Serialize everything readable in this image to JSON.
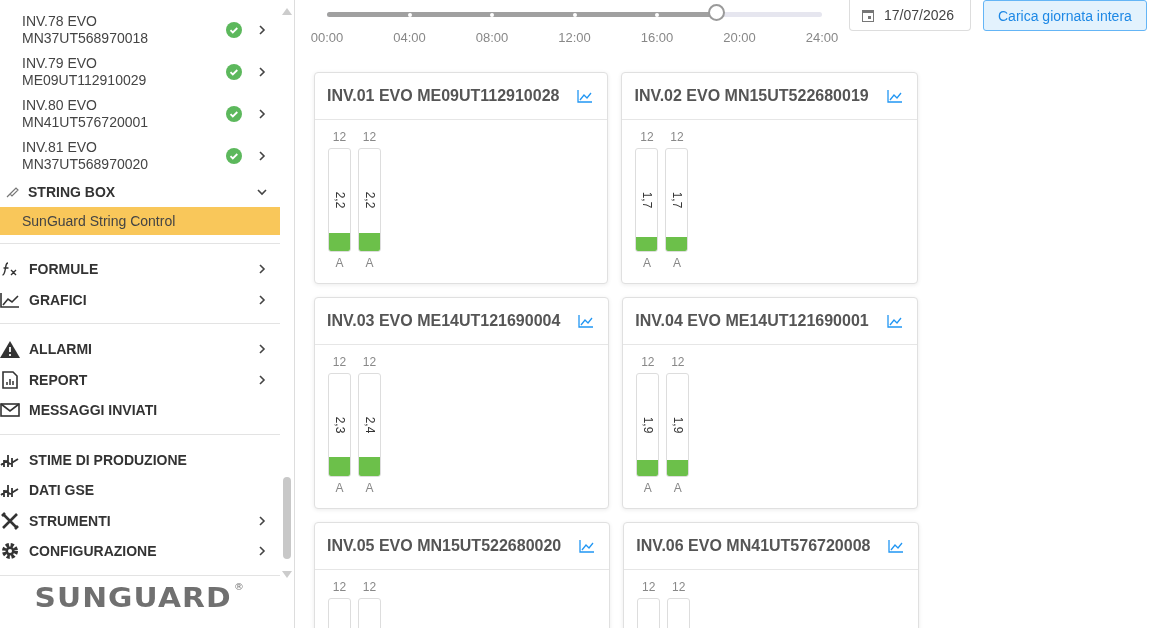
{
  "sidebar": {
    "inverters": [
      {
        "line1": "INV.78 EVO",
        "line2": "MN37UT568970018",
        "ok": true
      },
      {
        "line1": "INV.79 EVO",
        "line2": "ME09UT112910029",
        "ok": true
      },
      {
        "line1": "INV.80 EVO",
        "line2": "MN41UT576720001",
        "ok": true
      },
      {
        "line1": "INV.81 EVO",
        "line2": "MN37UT568970020",
        "ok": true
      }
    ],
    "string_box": {
      "label": "STRING BOX",
      "expanded": true,
      "children": [
        {
          "label": "SunGuard String Control",
          "selected": true
        }
      ]
    },
    "groups": [
      [
        {
          "label": "FORMULE",
          "submenu": true
        },
        {
          "label": "GRAFICI",
          "submenu": true
        }
      ],
      [
        {
          "label": "ALLARMI",
          "submenu": true
        },
        {
          "label": "REPORT",
          "submenu": true
        },
        {
          "label": "MESSAGGI INVIATI",
          "submenu": false
        }
      ],
      [
        {
          "label": "STIME DI PRODUZIONE",
          "submenu": false
        },
        {
          "label": "DATI GSE",
          "submenu": false
        },
        {
          "label": "STRUMENTI",
          "submenu": true
        },
        {
          "label": "CONFIGURAZIONE",
          "submenu": true
        }
      ]
    ],
    "logo": {
      "text": "SUNGUARD",
      "mark": "®"
    }
  },
  "timeline": {
    "level": 0.79,
    "ticks": [
      "00:00",
      "04:00",
      "08:00",
      "12:00",
      "16:00",
      "20:00",
      "24:00"
    ]
  },
  "date_field": {
    "value": "17/07/2026"
  },
  "load_button": "Carica giornata intera",
  "cards": [
    {
      "title": "INV.01 EVO ME09UT112910028",
      "strings": [
        {
          "max": "12",
          "value": "2,2",
          "level": 0.18,
          "unit": "A"
        },
        {
          "max": "12",
          "value": "2,2",
          "level": 0.18,
          "unit": "A"
        }
      ]
    },
    {
      "title": "INV.02 EVO MN15UT522680019",
      "strings": [
        {
          "max": "12",
          "value": "1,7",
          "level": 0.14,
          "unit": "A"
        },
        {
          "max": "12",
          "value": "1,7",
          "level": 0.14,
          "unit": "A"
        }
      ]
    },
    {
      "title": "INV.03 EVO ME14UT121690004",
      "strings": [
        {
          "max": "12",
          "value": "2,3",
          "level": 0.19,
          "unit": "A"
        },
        {
          "max": "12",
          "value": "2,4",
          "level": 0.19,
          "unit": "A"
        }
      ]
    },
    {
      "title": "INV.04 EVO ME14UT121690001",
      "strings": [
        {
          "max": "12",
          "value": "1,9",
          "level": 0.16,
          "unit": "A"
        },
        {
          "max": "12",
          "value": "1,9",
          "level": 0.16,
          "unit": "A"
        }
      ]
    },
    {
      "title": "INV.05 EVO MN15UT522680020",
      "strings": [
        {
          "max": "12"
        },
        {
          "max": "12"
        }
      ]
    },
    {
      "title": "INV.06 EVO MN41UT576720008",
      "strings": [
        {
          "max": "12"
        },
        {
          "max": "12"
        }
      ]
    }
  ]
}
